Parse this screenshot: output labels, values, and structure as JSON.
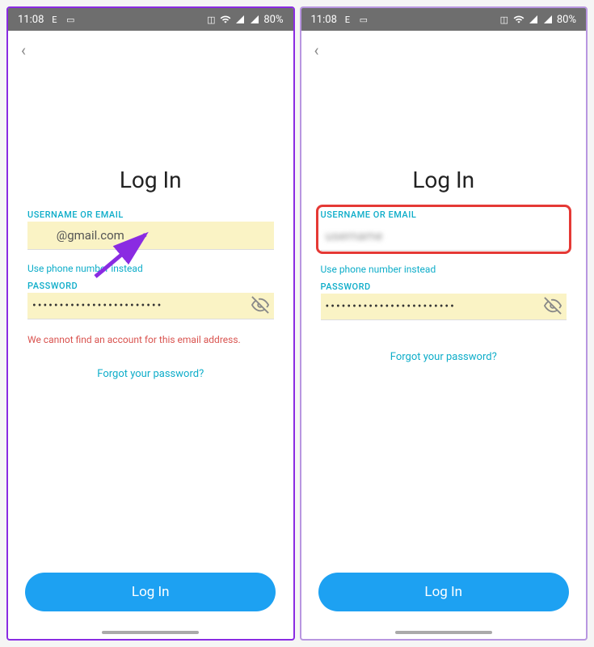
{
  "statusbar": {
    "time": "11:08",
    "battery": "80%"
  },
  "nav": {
    "back": "‹"
  },
  "login": {
    "title": "Log In",
    "username_label": "USERNAME OR EMAIL",
    "password_label": "PASSWORD",
    "use_phone": "Use phone number instead",
    "forgot": "Forgot your password?",
    "button": "Log In"
  },
  "left_screen": {
    "email_value": "@gmail.com",
    "password_value": "••••••••••••••••••••••••",
    "error": "We cannot find an account for this email address."
  },
  "right_screen": {
    "email_value": "",
    "password_value": "••••••••••••••••••••••••"
  }
}
